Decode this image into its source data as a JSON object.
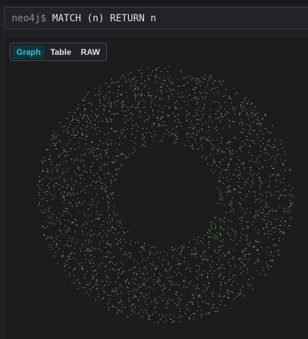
{
  "query_bar": {
    "prompt": "neo4j$",
    "query": "MATCH (n) RETURN n"
  },
  "view_toggle": {
    "options": [
      "Graph",
      "Table",
      "RAW"
    ],
    "selected": "Graph"
  },
  "graph": {
    "node_color": "#8fbf5a",
    "background": "#1b1c1e"
  },
  "colors": {
    "accent": "#38c0d6",
    "accent_bg": "#11353c"
  }
}
